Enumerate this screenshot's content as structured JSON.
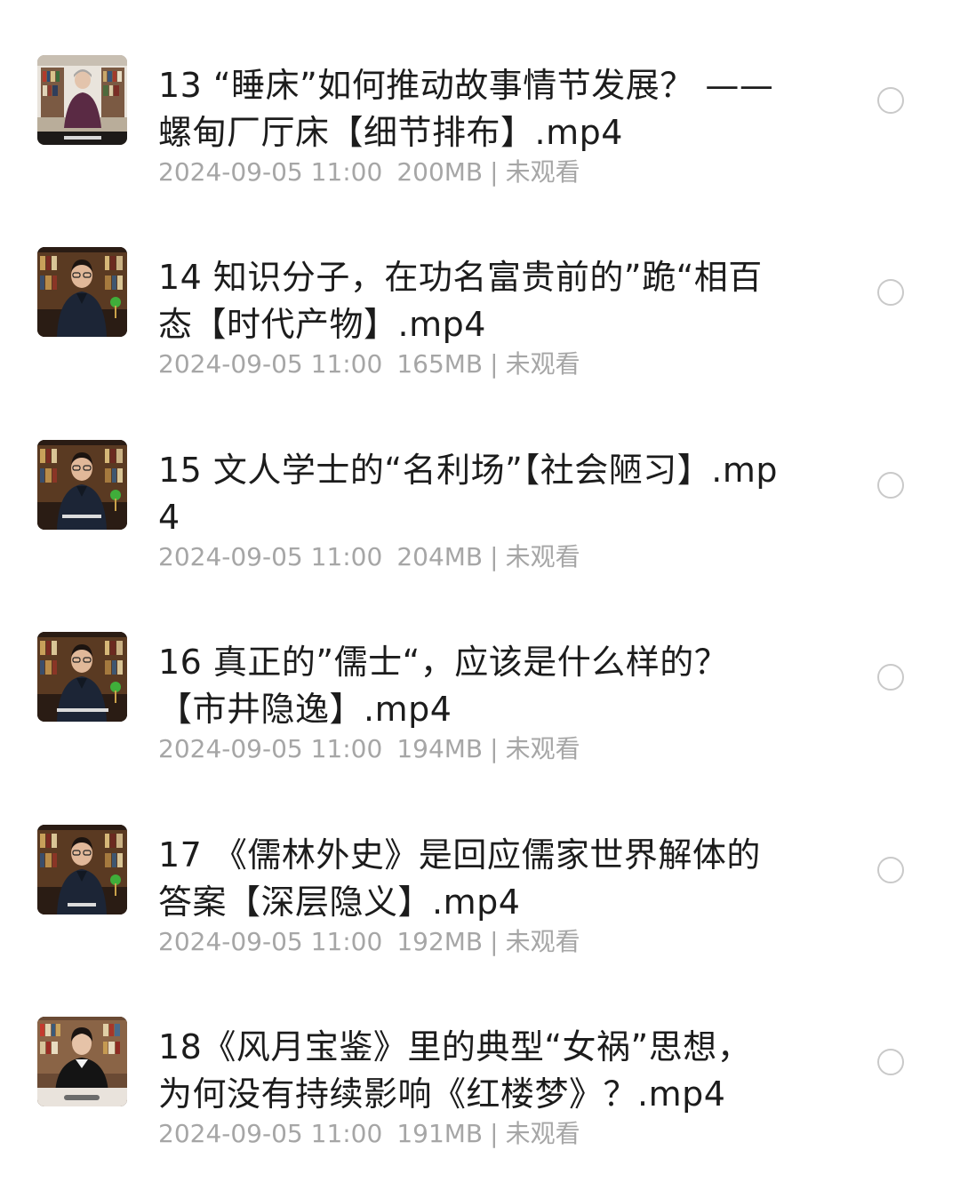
{
  "items": [
    {
      "title": "13 “睡床”如何推动故事情节发展？ ——螺甸厂厅床【细节排布】.mp4",
      "date": "2024-09-05 11:00",
      "size": "200MB",
      "status": "未观看",
      "thumb": "female-lecturer-bookshelf"
    },
    {
      "title": "14 知识分子，在功名富贵前的”跪“相百态【时代产物】.mp4",
      "date": "2024-09-05 11:00",
      "size": "165MB",
      "status": "未观看",
      "thumb": "male-lecturer-bookshelf"
    },
    {
      "title": "15 文人学士的“名利场”【社会陋习】.mp4",
      "date": "2024-09-05 11:00",
      "size": "204MB",
      "status": "未观看",
      "thumb": "male-lecturer-bookshelf"
    },
    {
      "title": "16 真正的”儒士“，应该是什么样的？ 【市井隐逸】.mp4",
      "date": "2024-09-05 11:00",
      "size": "194MB",
      "status": "未观看",
      "thumb": "male-lecturer-bookshelf"
    },
    {
      "title": "17 《儒林外史》是回应儒家世界解体的答案【深层隐义】.mp4",
      "date": "2024-09-05 11:00",
      "size": "192MB",
      "status": "未观看",
      "thumb": "male-lecturer-bookshelf"
    },
    {
      "title": "18《风月宝鉴》里的典型“女祸”思想，为何没有持续影响《红楼梦》？.mp4",
      "date": "2024-09-05 11:00",
      "size": "191MB",
      "status": "未观看",
      "thumb": "female-lecturer-desk"
    }
  ],
  "colors": {
    "title": "#1c1c1c",
    "meta": "#a6a6a6",
    "radio_border": "#c9c9c9"
  }
}
